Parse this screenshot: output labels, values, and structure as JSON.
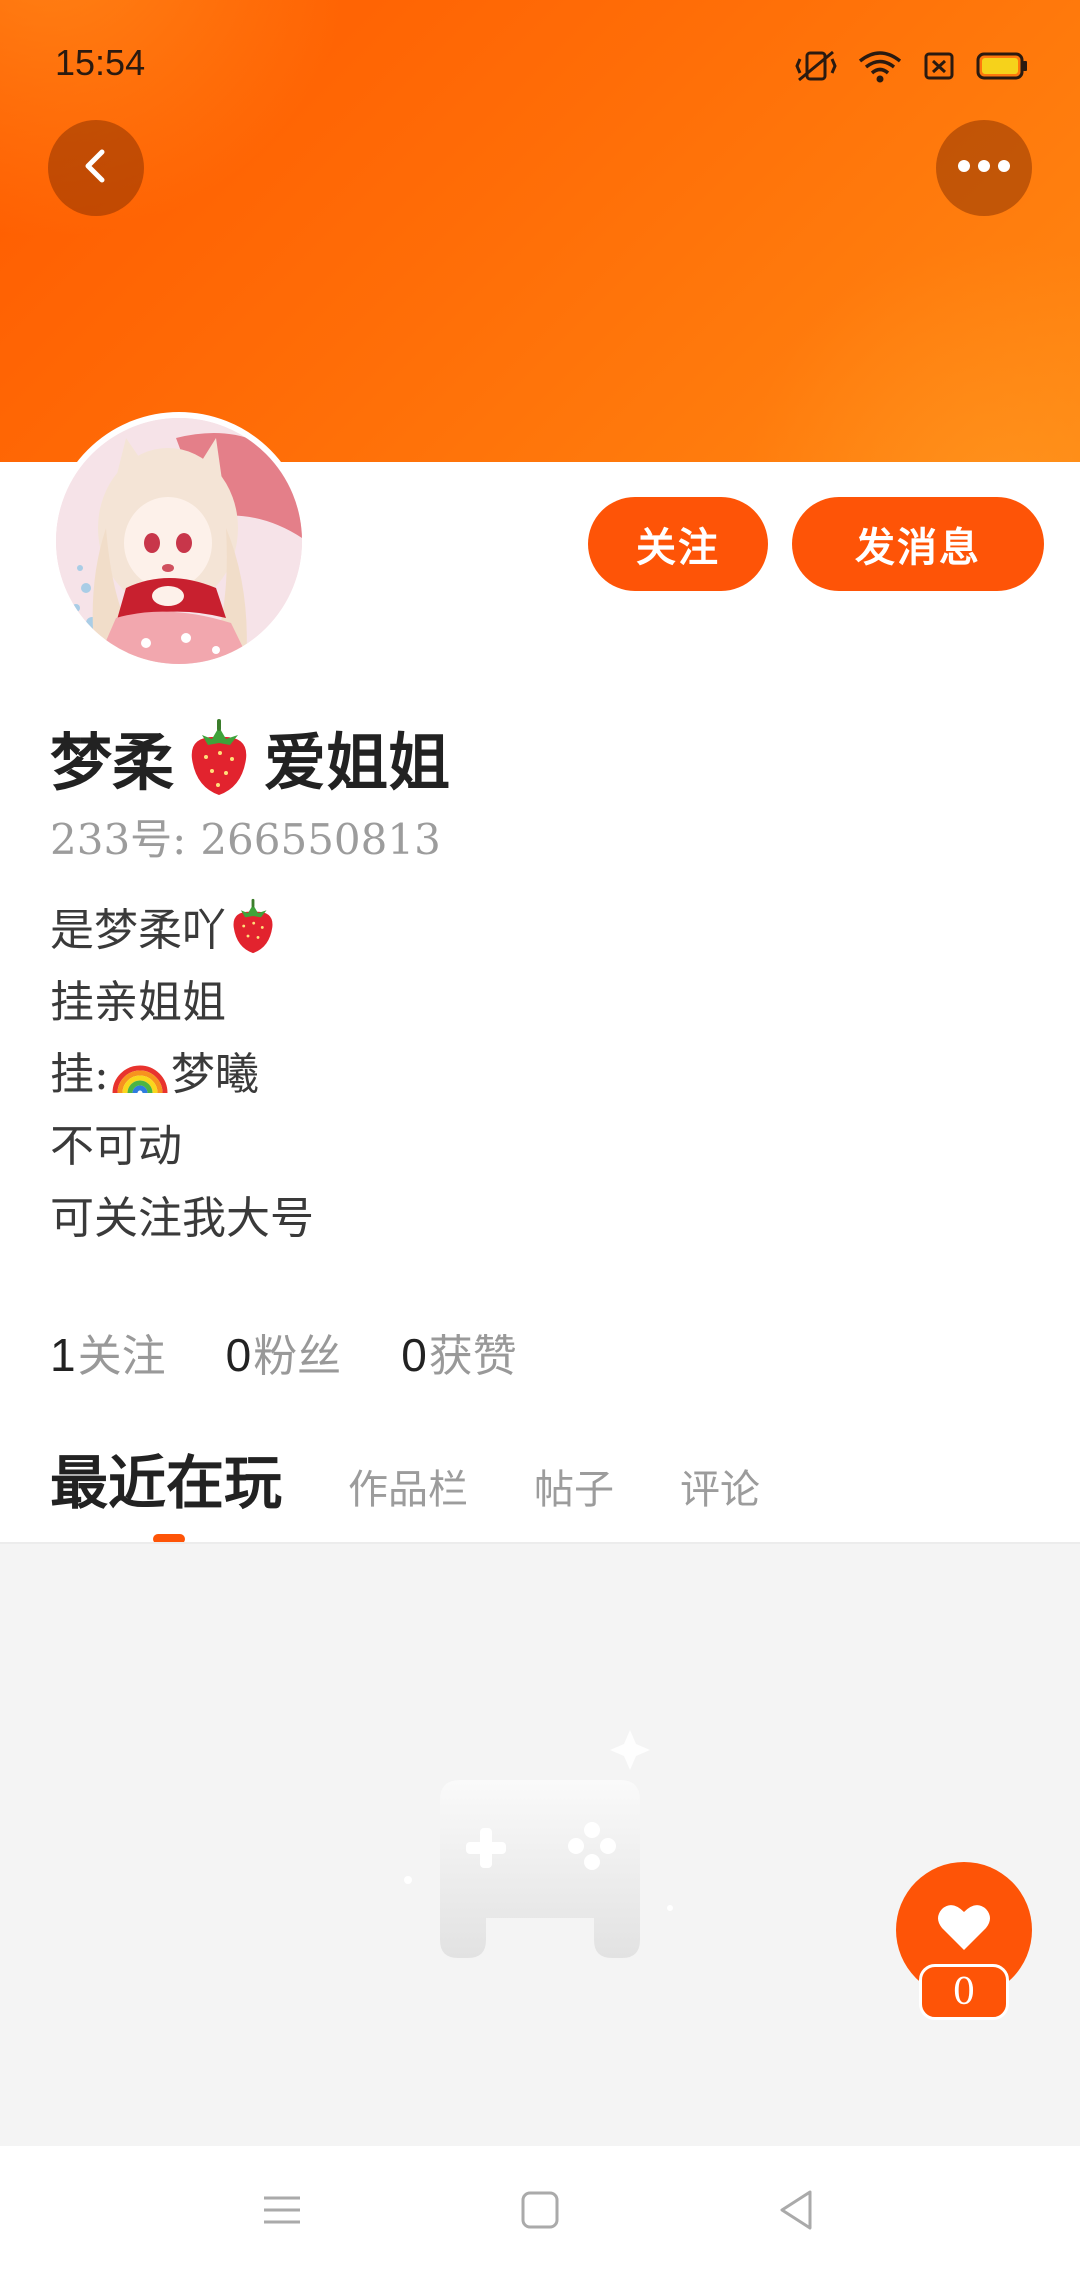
{
  "status_bar": {
    "time": "15:54"
  },
  "header": {
    "back_icon": "chevron-left-icon",
    "more_icon": "more-dots-icon",
    "colors": {
      "banner_start": "#ff5a00",
      "banner_end": "#ff8712"
    }
  },
  "profile": {
    "follow_label": "关注",
    "message_label": "发消息",
    "name_part1": "梦柔",
    "name_emoji": "strawberry-icon",
    "name_part2": "爱姐姐",
    "id_label": "233号:",
    "id_value": "266550813",
    "bio": {
      "line1_text": "是梦柔吖",
      "line1_emoji": "strawberry-icon",
      "line2": "挂亲姐姐",
      "line3_prefix": "挂:",
      "line3_emoji": "rainbow-icon",
      "line3_suffix": "梦曦",
      "line4": "不可动",
      "line5": "可关注我大号"
    },
    "stats": [
      {
        "value": "1",
        "label": "关注"
      },
      {
        "value": "0",
        "label": "粉丝"
      },
      {
        "value": "0",
        "label": "获赞"
      }
    ]
  },
  "tabs": {
    "items": [
      "最近在玩",
      "作品栏",
      "帖子",
      "评论"
    ],
    "active_index": 0
  },
  "content": {
    "empty_state_icon": "gamepad-icon",
    "like_icon": "heart-icon",
    "like_count": "0"
  },
  "nav_bar": {
    "icons": [
      "menu-icon",
      "home-square-icon",
      "back-triangle-icon"
    ]
  },
  "accent_color": "#fe5407"
}
